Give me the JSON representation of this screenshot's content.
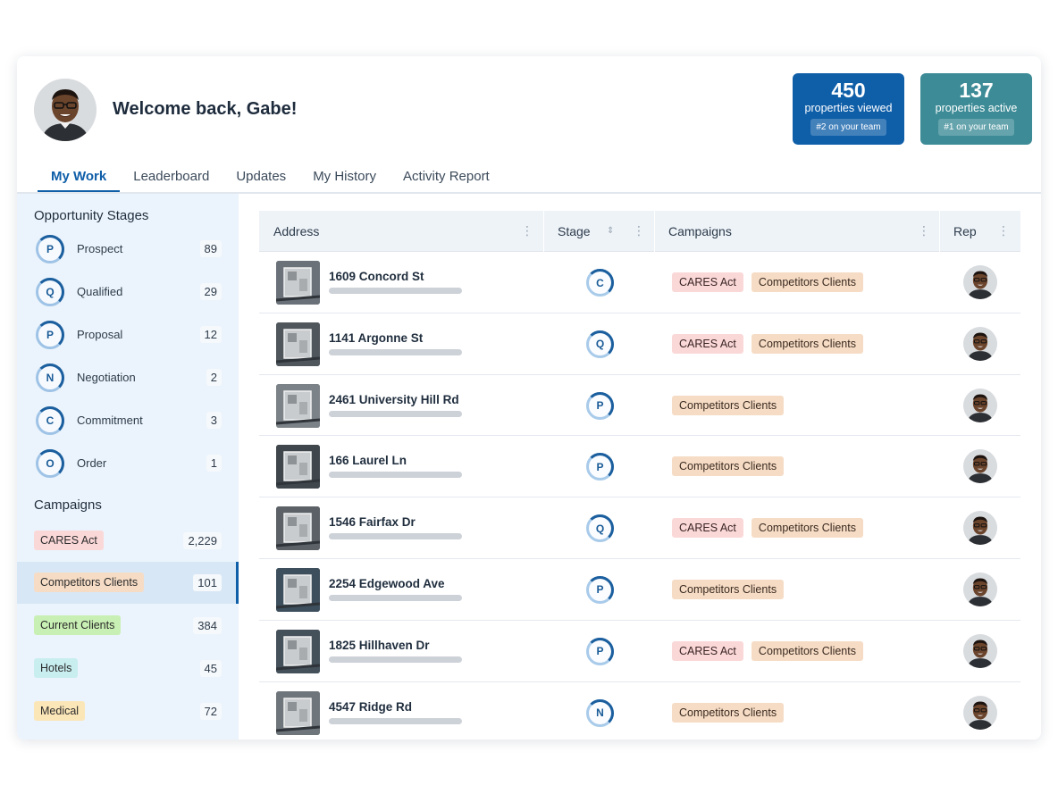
{
  "header": {
    "welcome": "Welcome back, Gabe!",
    "stats": [
      {
        "value": "450",
        "label": "properties viewed",
        "rank": "#2 on your team",
        "color": "#0f5ea8"
      },
      {
        "value": "137",
        "label": "properties active",
        "rank": "#1 on your team",
        "color": "#3c8b96"
      }
    ]
  },
  "tabs": [
    {
      "label": "My Work",
      "active": true
    },
    {
      "label": "Leaderboard",
      "active": false
    },
    {
      "label": "Updates",
      "active": false
    },
    {
      "label": "My History",
      "active": false
    },
    {
      "label": "Activity Report",
      "active": false
    }
  ],
  "sidebar": {
    "stages_title": "Opportunity Stages",
    "stages": [
      {
        "letter": "P",
        "label": "Prospect",
        "count": "89"
      },
      {
        "letter": "Q",
        "label": "Qualified",
        "count": "29"
      },
      {
        "letter": "P",
        "label": "Proposal",
        "count": "12"
      },
      {
        "letter": "N",
        "label": "Negotiation",
        "count": "2"
      },
      {
        "letter": "C",
        "label": "Commitment",
        "count": "3"
      },
      {
        "letter": "O",
        "label": "Order",
        "count": "1"
      }
    ],
    "campaigns_title": "Campaigns",
    "campaigns": [
      {
        "label": "CARES Act",
        "count": "2,229",
        "color": "#fbd8d8",
        "selected": false
      },
      {
        "label": "Competitors Clients",
        "count": "101",
        "color": "#f6dcc5",
        "selected": true
      },
      {
        "label": "Current Clients",
        "count": "384",
        "color": "#c9f0b4",
        "selected": false
      },
      {
        "label": "Hotels",
        "count": "45",
        "color": "#c9eef0",
        "selected": false
      },
      {
        "label": "Medical",
        "count": "72",
        "color": "#fbe6b8",
        "selected": false
      }
    ]
  },
  "table": {
    "columns": [
      "Address",
      "Stage",
      "Campaigns",
      "Rep"
    ],
    "rows": [
      {
        "address": "1609 Concord St",
        "stage": "C",
        "campaigns": [
          "CARES Act",
          "Competitors Clients"
        ]
      },
      {
        "address": "1141 Argonne St",
        "stage": "Q",
        "campaigns": [
          "CARES Act",
          "Competitors Clients"
        ]
      },
      {
        "address": "2461 University Hill Rd",
        "stage": "P",
        "campaigns": [
          "Competitors Clients"
        ]
      },
      {
        "address": "166 Laurel Ln",
        "stage": "P",
        "campaigns": [
          "Competitors Clients"
        ]
      },
      {
        "address": "1546 Fairfax Dr",
        "stage": "Q",
        "campaigns": [
          "CARES Act",
          "Competitors Clients"
        ]
      },
      {
        "address": "2254 Edgewood Ave",
        "stage": "P",
        "campaigns": [
          "Competitors Clients"
        ]
      },
      {
        "address": "1825 Hillhaven Dr",
        "stage": "P",
        "campaigns": [
          "CARES Act",
          "Competitors Clients"
        ]
      },
      {
        "address": "4547 Ridge Rd",
        "stage": "N",
        "campaigns": [
          "Competitors Clients"
        ]
      }
    ]
  },
  "icons": {
    "kebab": "more-vertical-icon",
    "sort": "sort-icon",
    "stage": "stage-ring-icon"
  }
}
